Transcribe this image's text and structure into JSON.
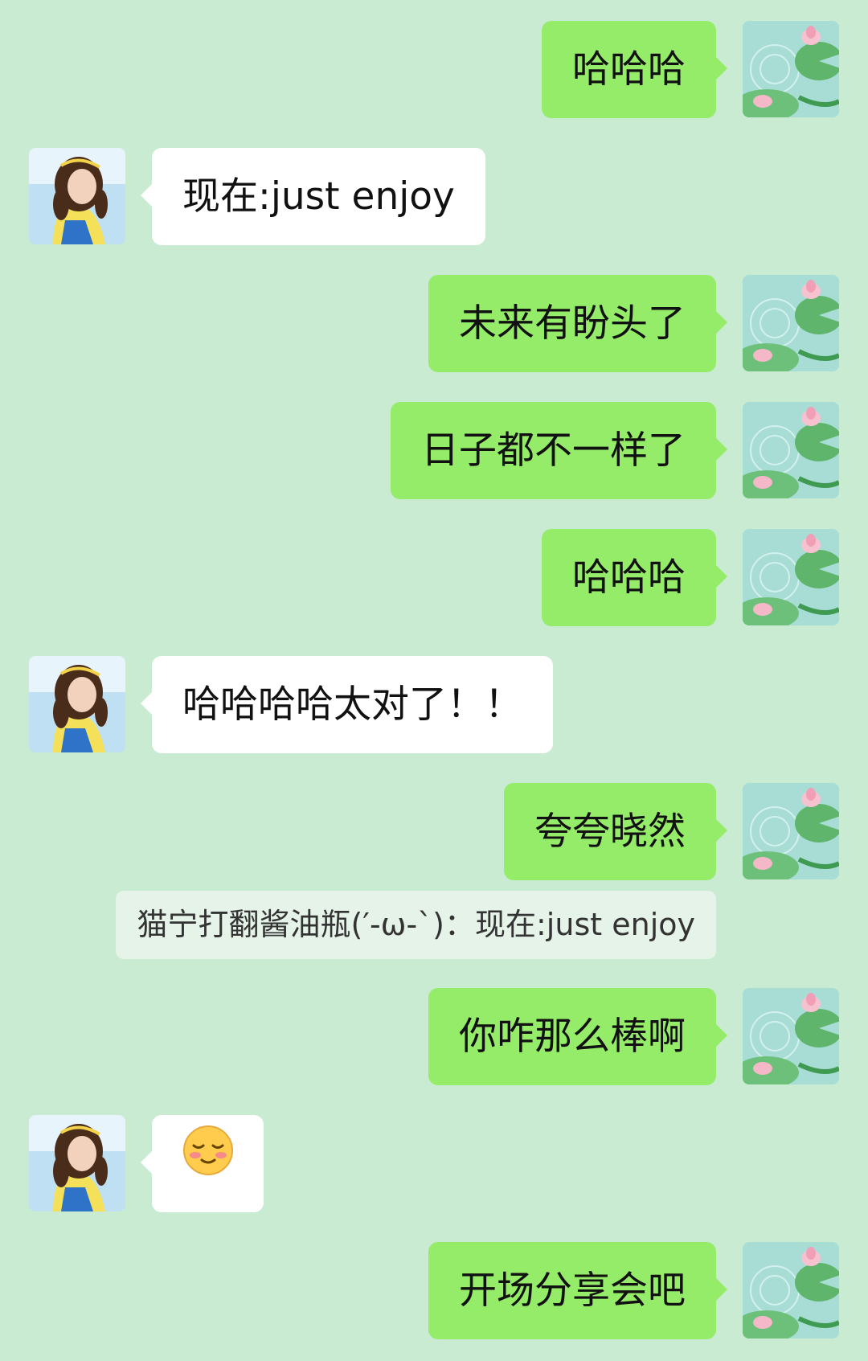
{
  "messages": [
    {
      "from": "self",
      "text": "哈哈哈"
    },
    {
      "from": "other",
      "text": "现在:just enjoy"
    },
    {
      "from": "self",
      "text": "未来有盼头了"
    },
    {
      "from": "self",
      "text": "日子都不一样了"
    },
    {
      "from": "self",
      "text": "哈哈哈"
    },
    {
      "from": "other",
      "text": "哈哈哈哈太对了！！"
    },
    {
      "from": "self",
      "text": "夸夸晓然"
    },
    {
      "from": "self",
      "text": "你咋那么棒啊"
    },
    {
      "from": "other",
      "emoji": "blushing-smile"
    },
    {
      "from": "self",
      "text": "开场分享会吧"
    }
  ],
  "quote": {
    "text": "猫宁打翻酱油瓶(′-ω-`)：现在:just enjoy"
  },
  "colors": {
    "background": "#c9ebd2",
    "self_bubble": "#95ec69",
    "other_bubble": "#ffffff",
    "quote_bg": "#e5f3e9"
  },
  "icons": {
    "self_avatar": "lotus-pond-avatar",
    "other_avatar": "girl-portrait-avatar"
  }
}
